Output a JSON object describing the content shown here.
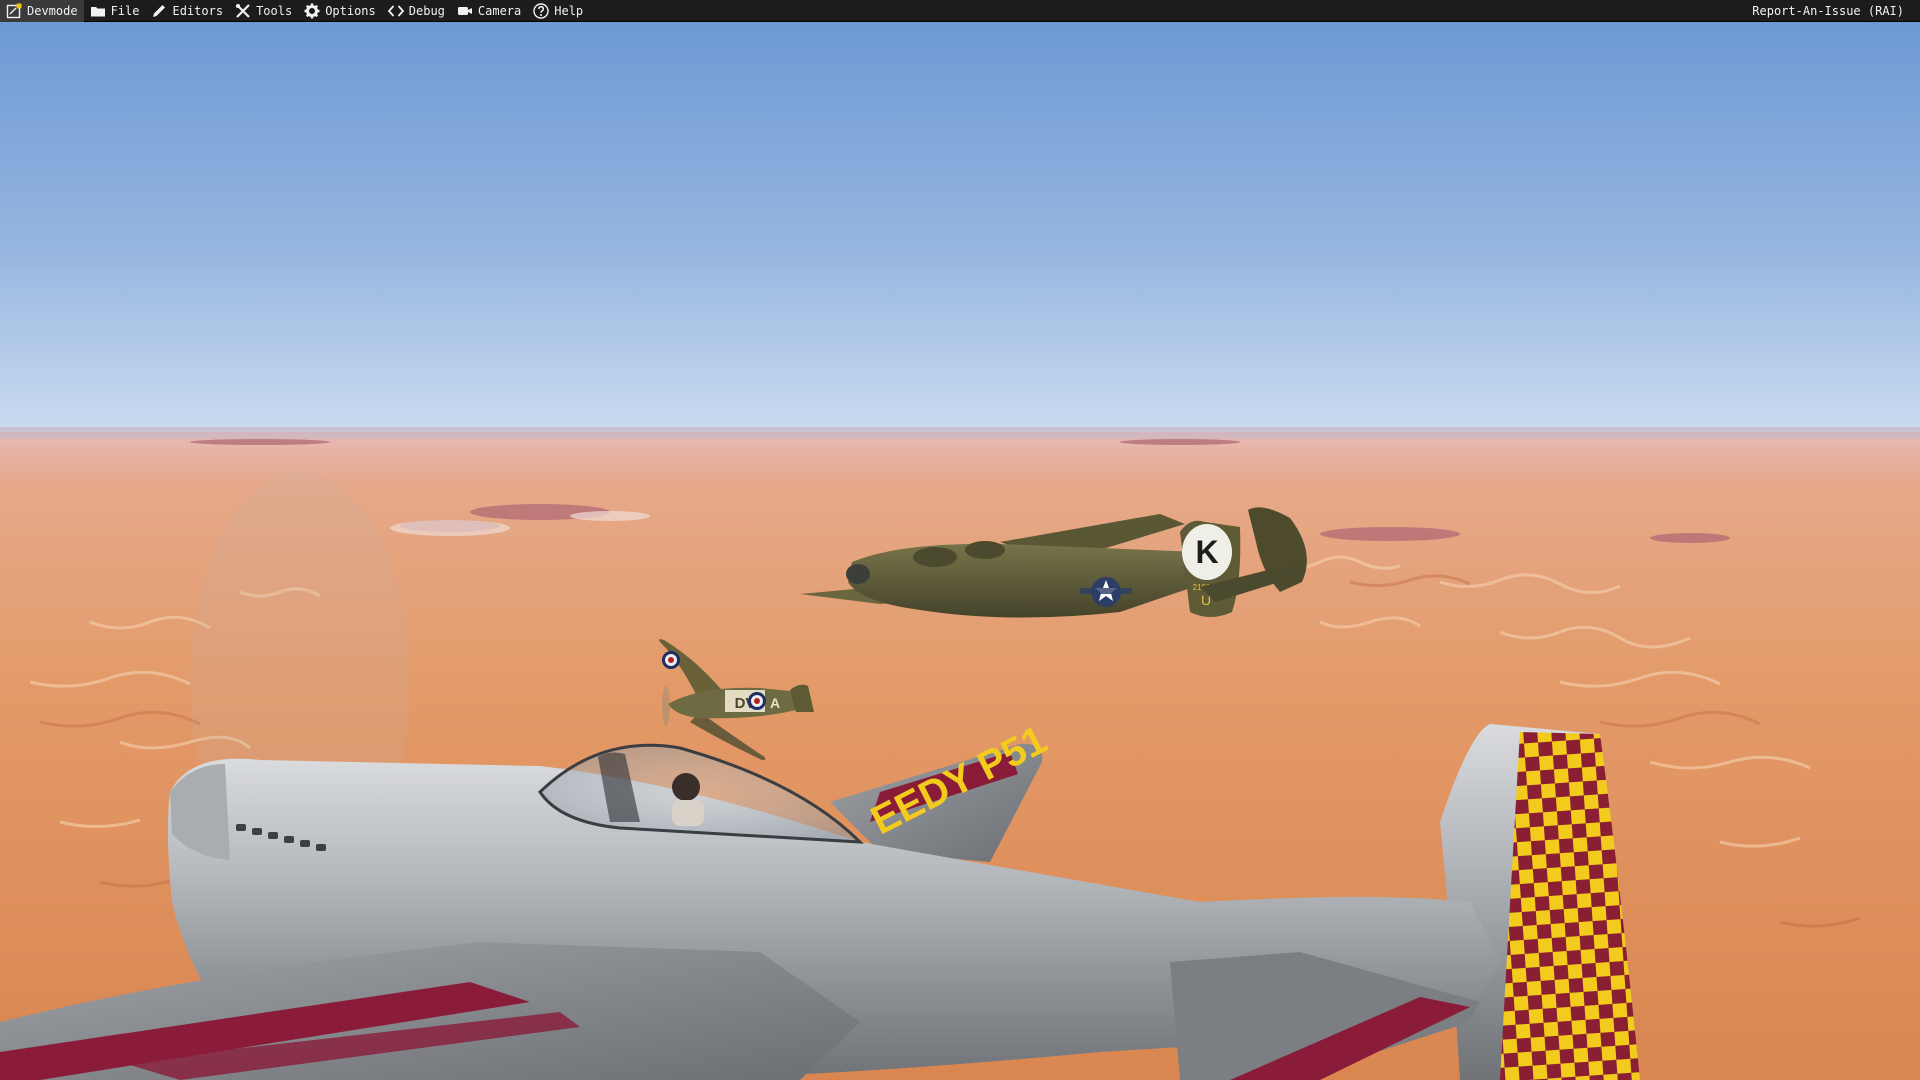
{
  "menubar": {
    "items": [
      {
        "label": "Devmode",
        "icon": "devmode-icon"
      },
      {
        "label": "File",
        "icon": "folder-icon"
      },
      {
        "label": "Editors",
        "icon": "pencil-icon"
      },
      {
        "label": "Tools",
        "icon": "tools-icon"
      },
      {
        "label": "Options",
        "icon": "gear-icon"
      },
      {
        "label": "Debug",
        "icon": "code-icon"
      },
      {
        "label": "Camera",
        "icon": "camera-icon"
      },
      {
        "label": "Help",
        "icon": "help-icon"
      }
    ],
    "report_label": "Report-An-Issue (RAI)"
  },
  "scene": {
    "bomber_code_letter": "K",
    "bomber_serial": "210141",
    "bomber_tail_letter": "U",
    "fighter_code": "DV",
    "fighter_code_letter": "A",
    "p51_wing_text": "EEDY P51"
  },
  "colors": {
    "menubar_bg": "#1c1c1e",
    "menubar_text": "#f2f2f2",
    "sky_top": "#6f9bd6",
    "sky_horizon": "#c9d9ee",
    "desert": "#e09a6c",
    "olive_drab": "#5d5a35",
    "p51_silver": "#b9bcc0",
    "p51_stripe": "#8a1c3a",
    "checker_yellow": "#f4cc1a"
  }
}
